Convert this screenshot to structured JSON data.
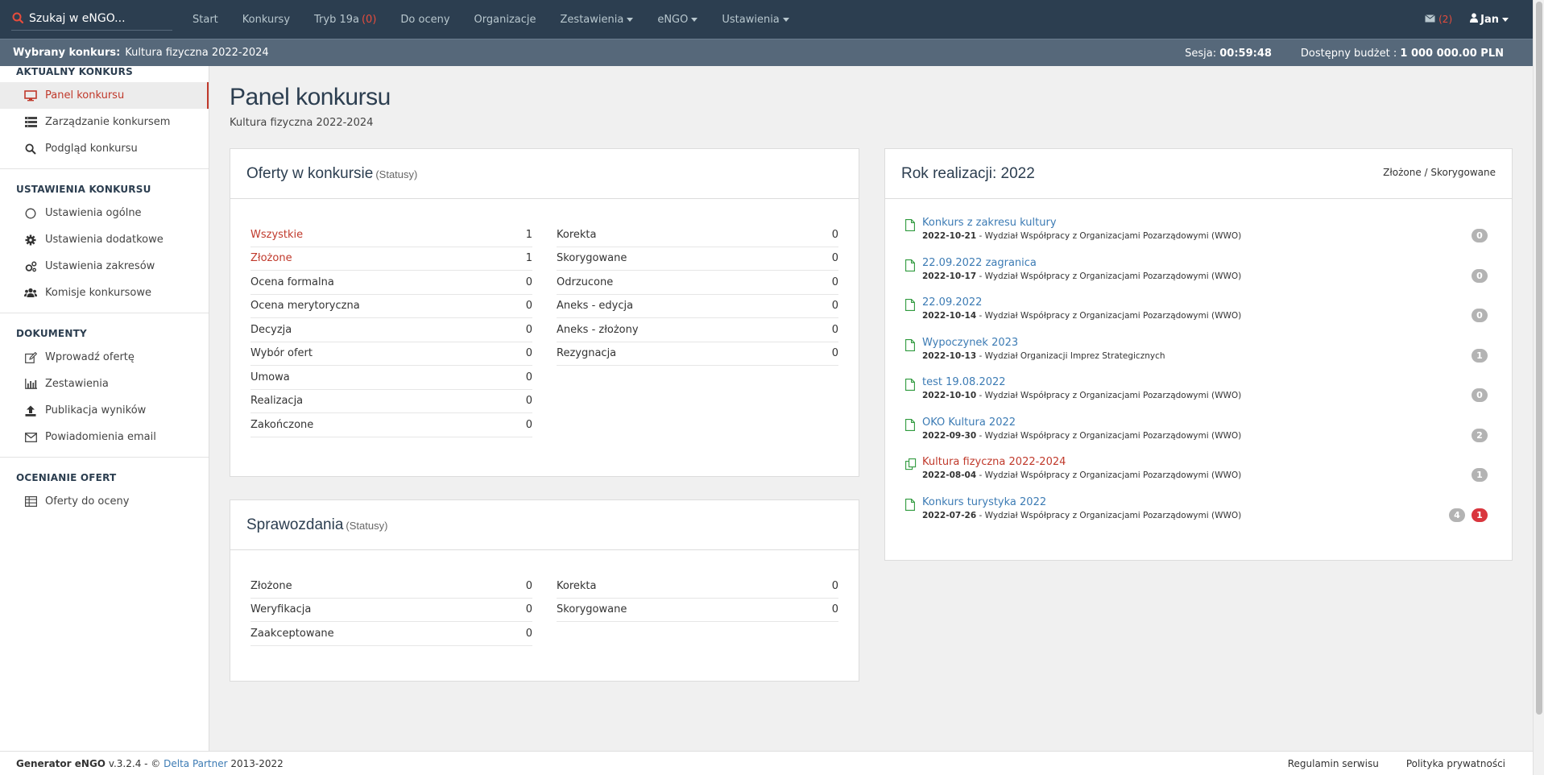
{
  "colors": {
    "navbar": "#2c3e50",
    "subbar": "#56687a",
    "accent_red": "#c0392b",
    "link_blue": "#3c7bb4",
    "badge_gray": "#b3b3b3",
    "badge_red": "#d9363e"
  },
  "topbar": {
    "search_placeholder": "Szukaj w eNGO...",
    "nav": [
      {
        "label": "Start"
      },
      {
        "label": "Konkursy"
      },
      {
        "label": "Tryb 19a",
        "count": "(0)"
      },
      {
        "label": "Do oceny"
      },
      {
        "label": "Organizacje"
      },
      {
        "label": "Zestawienia",
        "dropdown": true
      },
      {
        "label": "eNGO",
        "dropdown": true
      },
      {
        "label": "Ustawienia",
        "dropdown": true
      }
    ],
    "mail_count": "(2)",
    "user": "Jan"
  },
  "subbar": {
    "selected_label": "Wybrany konkurs:",
    "selected_value": "Kultura fizyczna 2022-2024",
    "session_label": "Sesja:",
    "session_value": "00:59:48",
    "budget_label": "Dostępny budżet :",
    "budget_value": "1 000 000.00 PLN"
  },
  "sidebar": {
    "sections": [
      {
        "title": "AKTUALNY KONKURS",
        "items": [
          {
            "label": "Panel konkursu",
            "icon": "monitor-icon",
            "active": true
          },
          {
            "label": "Zarządzanie konkursem",
            "icon": "list-icon"
          },
          {
            "label": "Podgląd konkursu",
            "icon": "search-icon"
          }
        ]
      },
      {
        "title": "USTAWIENIA KONKURSU",
        "items": [
          {
            "label": "Ustawienia ogólne",
            "icon": "circle-icon"
          },
          {
            "label": "Ustawienia dodatkowe",
            "icon": "gear-icon"
          },
          {
            "label": "Ustawienia zakresów",
            "icon": "gears-icon"
          },
          {
            "label": "Komisje konkursowe",
            "icon": "users-icon"
          }
        ]
      },
      {
        "title": "DOKUMENTY",
        "items": [
          {
            "label": "Wprowadź ofertę",
            "icon": "edit-icon"
          },
          {
            "label": "Zestawienia",
            "icon": "bar-chart-icon"
          },
          {
            "label": "Publikacja wyników",
            "icon": "upload-icon"
          },
          {
            "label": "Powiadomienia email",
            "icon": "envelope-icon"
          }
        ]
      },
      {
        "title": "OCENIANIE OFERT",
        "items": [
          {
            "label": "Oferty do oceny",
            "icon": "table-icon"
          }
        ]
      }
    ]
  },
  "main": {
    "title": "Panel konkursu",
    "subtitle": "Kultura fizyczna 2022-2024",
    "offers_panel": {
      "title": "Oferty w konkursie",
      "title_small": "(Statusy)",
      "left": [
        {
          "label": "Wszystkie",
          "value": "1",
          "highlight": true
        },
        {
          "label": "Złożone",
          "value": "1",
          "highlight": true
        },
        {
          "label": "Ocena formalna",
          "value": "0"
        },
        {
          "label": "Ocena merytoryczna",
          "value": "0"
        },
        {
          "label": "Decyzja",
          "value": "0"
        },
        {
          "label": "Wybór ofert",
          "value": "0"
        },
        {
          "label": "Umowa",
          "value": "0"
        },
        {
          "label": "Realizacja",
          "value": "0"
        },
        {
          "label": "Zakończone",
          "value": "0"
        }
      ],
      "right": [
        {
          "label": "Korekta",
          "value": "0"
        },
        {
          "label": "Skorygowane",
          "value": "0"
        },
        {
          "label": "Odrzucone",
          "value": "0"
        },
        {
          "label": "Aneks - edycja",
          "value": "0"
        },
        {
          "label": "Aneks - złożony",
          "value": "0"
        },
        {
          "label": "Rezygnacja",
          "value": "0"
        }
      ]
    },
    "reports_panel": {
      "title": "Sprawozdania",
      "title_small": "(Statusy)",
      "left": [
        {
          "label": "Złożone",
          "value": "0"
        },
        {
          "label": "Weryfikacja",
          "value": "0"
        },
        {
          "label": "Zaakceptowane",
          "value": "0"
        }
      ],
      "right": [
        {
          "label": "Korekta",
          "value": "0"
        },
        {
          "label": "Skorygowane",
          "value": "0"
        }
      ]
    },
    "year_panel": {
      "title": "Rok realizacji: 2022",
      "legend": "Złożone / Skorygowane",
      "items": [
        {
          "name": "Konkurs z zakresu kultury",
          "date": "2022-10-21",
          "dept": " - Wydział Współpracy z Organizacjami Pozarządowymi (WWO)",
          "badges": [
            "0"
          ]
        },
        {
          "name": "22.09.2022 zagranica",
          "date": "2022-10-17",
          "dept": " - Wydział Współpracy z Organizacjami Pozarządowymi (WWO)",
          "badges": [
            "0"
          ]
        },
        {
          "name": "22.09.2022",
          "date": "2022-10-14",
          "dept": " - Wydział Współpracy z Organizacjami Pozarządowymi (WWO)",
          "badges": [
            "0"
          ]
        },
        {
          "name": "Wypoczynek 2023",
          "date": "2022-10-13",
          "dept": " - Wydział Organizacji Imprez Strategicznych",
          "badges": [
            "1"
          ]
        },
        {
          "name": "test 19.08.2022",
          "date": "2022-10-10",
          "dept": " - Wydział Współpracy z Organizacjami Pozarządowymi (WWO)",
          "badges": [
            "0"
          ]
        },
        {
          "name": "OKO Kultura 2022",
          "date": "2022-09-30",
          "dept": " - Wydział Współpracy z Organizacjami Pozarządowymi (WWO)",
          "badges": [
            "2"
          ]
        },
        {
          "name": "Kultura fizyczna 2022-2024",
          "date": "2022-08-04",
          "dept": " - Wydział Współpracy z Organizacjami Pozarządowymi (WWO)",
          "badges": [
            "1"
          ],
          "current": true
        },
        {
          "name": "Konkurs turystyka 2022",
          "date": "2022-07-26",
          "dept": " - Wydział Współpracy z Organizacjami Pozarządowymi (WWO)",
          "badges": [
            "4",
            "1"
          ]
        }
      ]
    }
  },
  "footer": {
    "brand": "Generator eNGO",
    "version": " v.3.2.4 - © ",
    "company": "Delta Partner",
    "years": " 2013-2022",
    "links": [
      "Regulamin serwisu",
      "Polityka prywatności"
    ]
  }
}
